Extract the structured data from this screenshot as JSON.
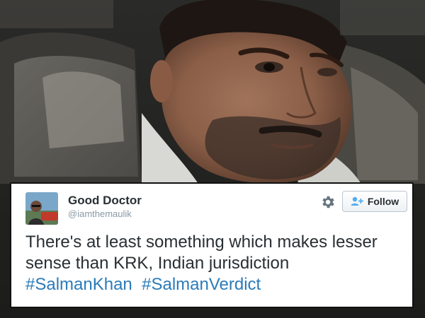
{
  "tweet": {
    "user_name": "Good Doctor",
    "user_handle": "@iamthemaulik",
    "follow_label": "Follow",
    "text_line1": "There's at least something which makes lesser",
    "text_line2": "sense than KRK, Indian jurisdiction",
    "hashtags": [
      "#SalmanKhan",
      "#SalmanVerdict"
    ]
  },
  "icons": {
    "settings": "gear-icon",
    "follow": "add-user-icon"
  },
  "colors": {
    "hashtag": "#2b7bb9",
    "handle": "#8899a6",
    "text": "#292f33",
    "follow_icon": "#55acee"
  }
}
